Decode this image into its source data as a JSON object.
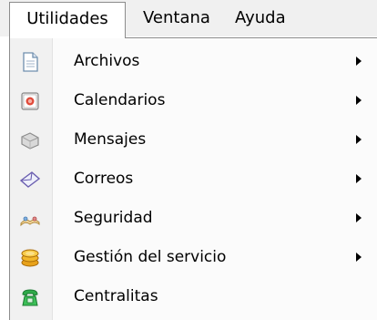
{
  "menubar": {
    "items": [
      {
        "label": "Utilidades",
        "active": true
      },
      {
        "label": "Ventana"
      },
      {
        "label": "Ayuda"
      }
    ]
  },
  "dropdown": {
    "items": [
      {
        "label": "Archivos",
        "icon": "document-icon",
        "submenu": true
      },
      {
        "label": "Calendarios",
        "icon": "calendar-icon",
        "submenu": true
      },
      {
        "label": "Mensajes",
        "icon": "message-icon",
        "submenu": true
      },
      {
        "label": "Correos",
        "icon": "envelope-icon",
        "submenu": true
      },
      {
        "label": "Seguridad",
        "icon": "keys-icon",
        "submenu": true
      },
      {
        "label": "Gestión del servicio",
        "icon": "coins-icon",
        "submenu": true
      },
      {
        "label": "Centralitas",
        "icon": "phone-icon",
        "submenu": false
      }
    ]
  }
}
